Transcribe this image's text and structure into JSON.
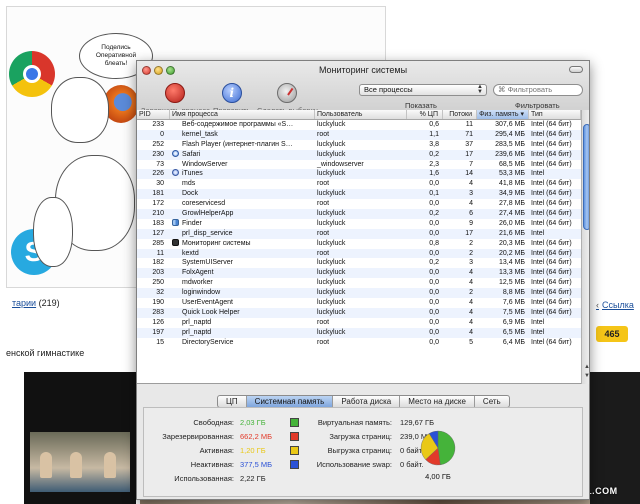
{
  "background": {
    "comic_bubble": "Поделись Оперативной блеать!",
    "comments_link": "тарии",
    "comments_count": "(219)",
    "article_fragment": "енской гимнастике",
    "link_right": "Ссылка",
    "link_arrow": "‹",
    "rating": "465",
    "watermark": "YAPLAKAL.COM"
  },
  "window": {
    "title": "Мониторинг системы",
    "toolbar": {
      "quit_label": "Завершить процесс",
      "info_label": "Проверить",
      "info_glyph": "i",
      "sample_label": "Сделать выборку",
      "process_filter": "Все процессы",
      "search_placeholder": "⌘ Фильтровать",
      "show_label": "Показать",
      "filter_label": "Фильтровать"
    },
    "columns": [
      "PID",
      "Имя процесса",
      "Пользователь",
      "% ЦП",
      "Потоки",
      "Физ. память ▾",
      "Тип"
    ],
    "processes": [
      {
        "pid": "233",
        "name": "Веб-содержимое программы «S…",
        "icon": "none",
        "user": "luckyluck",
        "cpu": "0,6",
        "threads": "11",
        "mem": "307,6 МБ",
        "type": "Intel (64 бит)"
      },
      {
        "pid": "0",
        "name": "kernel_task",
        "icon": "none",
        "user": "root",
        "cpu": "1,1",
        "threads": "71",
        "mem": "295,4 МБ",
        "type": "Intel (64 бит)"
      },
      {
        "pid": "252",
        "name": "Flash Player (интернет-плагин S…",
        "icon": "none",
        "user": "luckyluck",
        "cpu": "3,8",
        "threads": "37",
        "mem": "283,5 МБ",
        "type": "Intel (64 бит)"
      },
      {
        "pid": "230",
        "name": "Safari",
        "icon": "safari",
        "user": "luckyluck",
        "cpu": "0,2",
        "threads": "17",
        "mem": "239,6 МБ",
        "type": "Intel (64 бит)"
      },
      {
        "pid": "73",
        "name": "WindowServer",
        "icon": "none",
        "user": "_windowserver",
        "cpu": "2,3",
        "threads": "7",
        "mem": "68,5 МБ",
        "type": "Intel (64 бит)"
      },
      {
        "pid": "226",
        "name": "iTunes",
        "icon": "itunes",
        "user": "luckyluck",
        "cpu": "1,6",
        "threads": "14",
        "mem": "53,3 МБ",
        "type": "Intel"
      },
      {
        "pid": "30",
        "name": "mds",
        "icon": "none",
        "user": "root",
        "cpu": "0,0",
        "threads": "4",
        "mem": "41,8 МБ",
        "type": "Intel (64 бит)"
      },
      {
        "pid": "181",
        "name": "Dock",
        "icon": "none",
        "user": "luckyluck",
        "cpu": "0,1",
        "threads": "3",
        "mem": "34,9 МБ",
        "type": "Intel (64 бит)"
      },
      {
        "pid": "172",
        "name": "coreservicesd",
        "icon": "none",
        "user": "root",
        "cpu": "0,0",
        "threads": "4",
        "mem": "27,8 МБ",
        "type": "Intel (64 бит)"
      },
      {
        "pid": "210",
        "name": "GrowlHelperApp",
        "icon": "none",
        "user": "luckyluck",
        "cpu": "0,2",
        "threads": "6",
        "mem": "27,4 МБ",
        "type": "Intel (64 бит)"
      },
      {
        "pid": "183",
        "name": "Finder",
        "icon": "finder",
        "user": "luckyluck",
        "cpu": "0,0",
        "threads": "9",
        "mem": "26,0 МБ",
        "type": "Intel (64 бит)"
      },
      {
        "pid": "127",
        "name": "prl_disp_service",
        "icon": "none",
        "user": "root",
        "cpu": "0,0",
        "threads": "17",
        "mem": "21,6 МБ",
        "type": "Intel"
      },
      {
        "pid": "285",
        "name": "Мониторинг системы",
        "icon": "monitor",
        "user": "luckyluck",
        "cpu": "0,8",
        "threads": "2",
        "mem": "20,3 МБ",
        "type": "Intel (64 бит)"
      },
      {
        "pid": "11",
        "name": "kextd",
        "icon": "none",
        "user": "root",
        "cpu": "0,0",
        "threads": "2",
        "mem": "20,2 МБ",
        "type": "Intel (64 бит)"
      },
      {
        "pid": "182",
        "name": "SystemUIServer",
        "icon": "none",
        "user": "luckyluck",
        "cpu": "0,2",
        "threads": "3",
        "mem": "13,4 МБ",
        "type": "Intel (64 бит)"
      },
      {
        "pid": "203",
        "name": "FolxAgent",
        "icon": "none",
        "user": "luckyluck",
        "cpu": "0,0",
        "threads": "4",
        "mem": "13,3 МБ",
        "type": "Intel (64 бит)"
      },
      {
        "pid": "250",
        "name": "mdworker",
        "icon": "none",
        "user": "luckyluck",
        "cpu": "0,0",
        "threads": "4",
        "mem": "12,5 МБ",
        "type": "Intel (64 бит)"
      },
      {
        "pid": "32",
        "name": "loginwindow",
        "icon": "none",
        "user": "luckyluck",
        "cpu": "0,0",
        "threads": "2",
        "mem": "8,8 МБ",
        "type": "Intel (64 бит)"
      },
      {
        "pid": "190",
        "name": "UserEventAgent",
        "icon": "none",
        "user": "luckyluck",
        "cpu": "0,0",
        "threads": "4",
        "mem": "7,6 МБ",
        "type": "Intel (64 бит)"
      },
      {
        "pid": "283",
        "name": "Quick Look Helper",
        "icon": "none",
        "user": "luckyluck",
        "cpu": "0,0",
        "threads": "4",
        "mem": "7,5 МБ",
        "type": "Intel (64 бит)"
      },
      {
        "pid": "126",
        "name": "prl_naptd",
        "icon": "none",
        "user": "root",
        "cpu": "0,0",
        "threads": "4",
        "mem": "6,9 МБ",
        "type": "Intel"
      },
      {
        "pid": "197",
        "name": "prl_naptd",
        "icon": "none",
        "user": "luckyluck",
        "cpu": "0,0",
        "threads": "4",
        "mem": "6,5 МБ",
        "type": "Intel"
      },
      {
        "pid": "15",
        "name": "DirectoryService",
        "icon": "none",
        "user": "root",
        "cpu": "0,0",
        "threads": "5",
        "mem": "6,4 МБ",
        "type": "Intel (64 бит)"
      }
    ],
    "tabs": [
      {
        "label": "ЦП",
        "active": false
      },
      {
        "label": "Системная память",
        "active": true
      },
      {
        "label": "Работа диска",
        "active": false
      },
      {
        "label": "Место на диске",
        "active": false
      },
      {
        "label": "Сеть",
        "active": false
      }
    ],
    "memory": {
      "left": [
        {
          "label": "Свободная:",
          "value": "2,03 ГБ",
          "color": "#45b33a",
          "swatch": true
        },
        {
          "label": "Зарезервированная:",
          "value": "662,2 МБ",
          "color": "#e23a2a",
          "swatch": true
        },
        {
          "label": "Активная:",
          "value": "1,20 ГБ",
          "color": "#e9c817",
          "swatch": true
        },
        {
          "label": "Неактивная:",
          "value": "377,5 МБ",
          "color": "#2a51d6",
          "swatch": true
        },
        {
          "label": "Использованная:",
          "value": "2,22 ГБ",
          "color": "#222222",
          "swatch": false
        }
      ],
      "right": [
        {
          "label": "Виртуальная память:",
          "value": "129,67 ГБ"
        },
        {
          "label": "Загрузка страниц:",
          "value": "239,0 МБ"
        },
        {
          "label": "Выгрузка страниц:",
          "value": "0 байт."
        },
        {
          "label": "Использование swap:",
          "value": "0 байт."
        }
      ],
      "total": "4,00 ГБ",
      "pie_mb": [
        2079,
        662,
        1229,
        378
      ]
    }
  }
}
